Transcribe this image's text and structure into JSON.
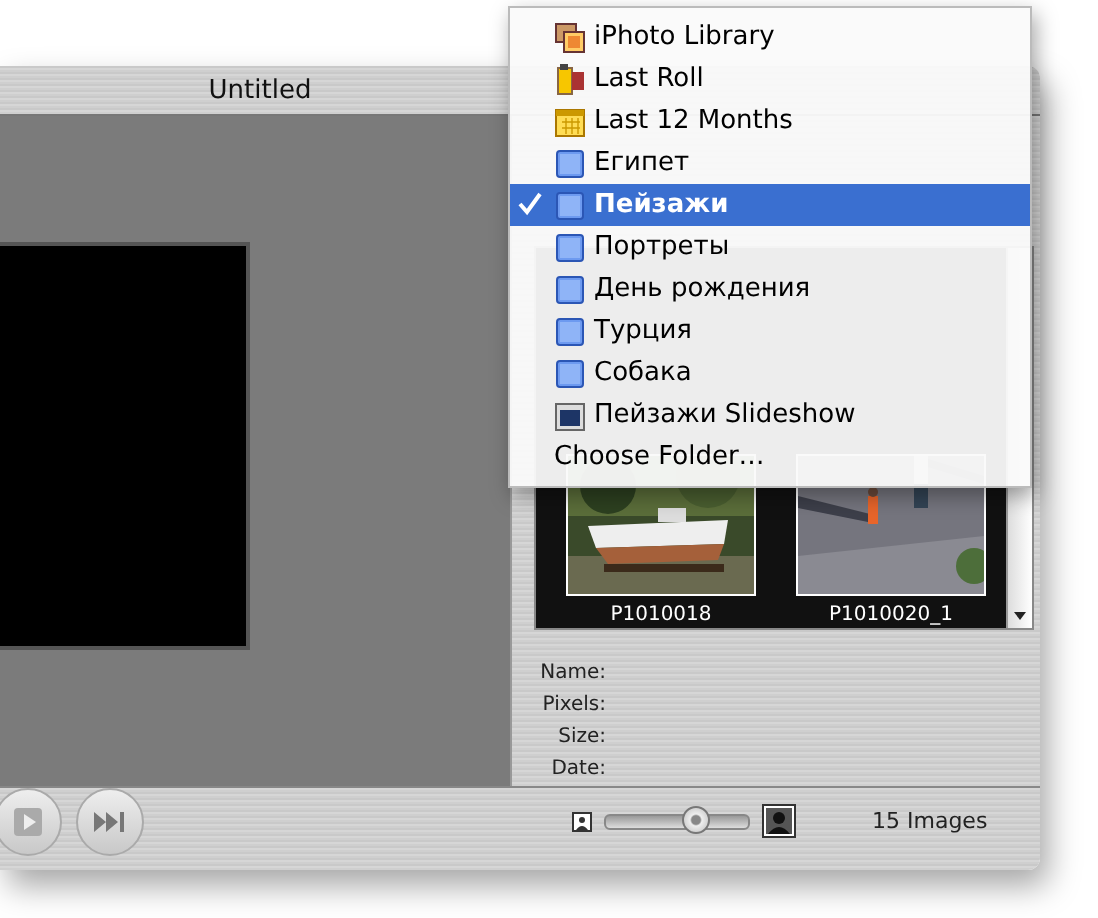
{
  "window": {
    "title": "Untitled"
  },
  "playback_buttons": [
    {
      "kind": "play"
    },
    {
      "kind": "next"
    }
  ],
  "thumbnails": [
    {
      "caption": "P1010018",
      "kind": "boat"
    },
    {
      "caption": "P1010020_1",
      "kind": "square"
    }
  ],
  "info_labels": [
    "Name:",
    "Pixels:",
    "Size:",
    "Date:"
  ],
  "zoom_slider": {
    "level": 0.63
  },
  "image_count": "15 Images",
  "menu": {
    "items": [
      {
        "label": "iPhoto Library",
        "kind": "library",
        "selected": false
      },
      {
        "label": "Last Roll",
        "kind": "roll",
        "selected": false
      },
      {
        "label": "Last 12 Months",
        "kind": "calendar",
        "selected": false
      },
      {
        "label": "Египет",
        "kind": "album",
        "selected": false
      },
      {
        "label": "Пейзажи",
        "kind": "album",
        "selected": true
      },
      {
        "label": "Портреты",
        "kind": "album",
        "selected": false
      },
      {
        "label": "День рождения",
        "kind": "album",
        "selected": false
      },
      {
        "label": "Турция",
        "kind": "album",
        "selected": false
      },
      {
        "label": "Собака",
        "kind": "album",
        "selected": false
      },
      {
        "label": "Пейзажи Slideshow",
        "kind": "slideshow",
        "selected": false
      },
      {
        "label": "Choose Folder…",
        "kind": "action",
        "selected": false
      }
    ]
  }
}
